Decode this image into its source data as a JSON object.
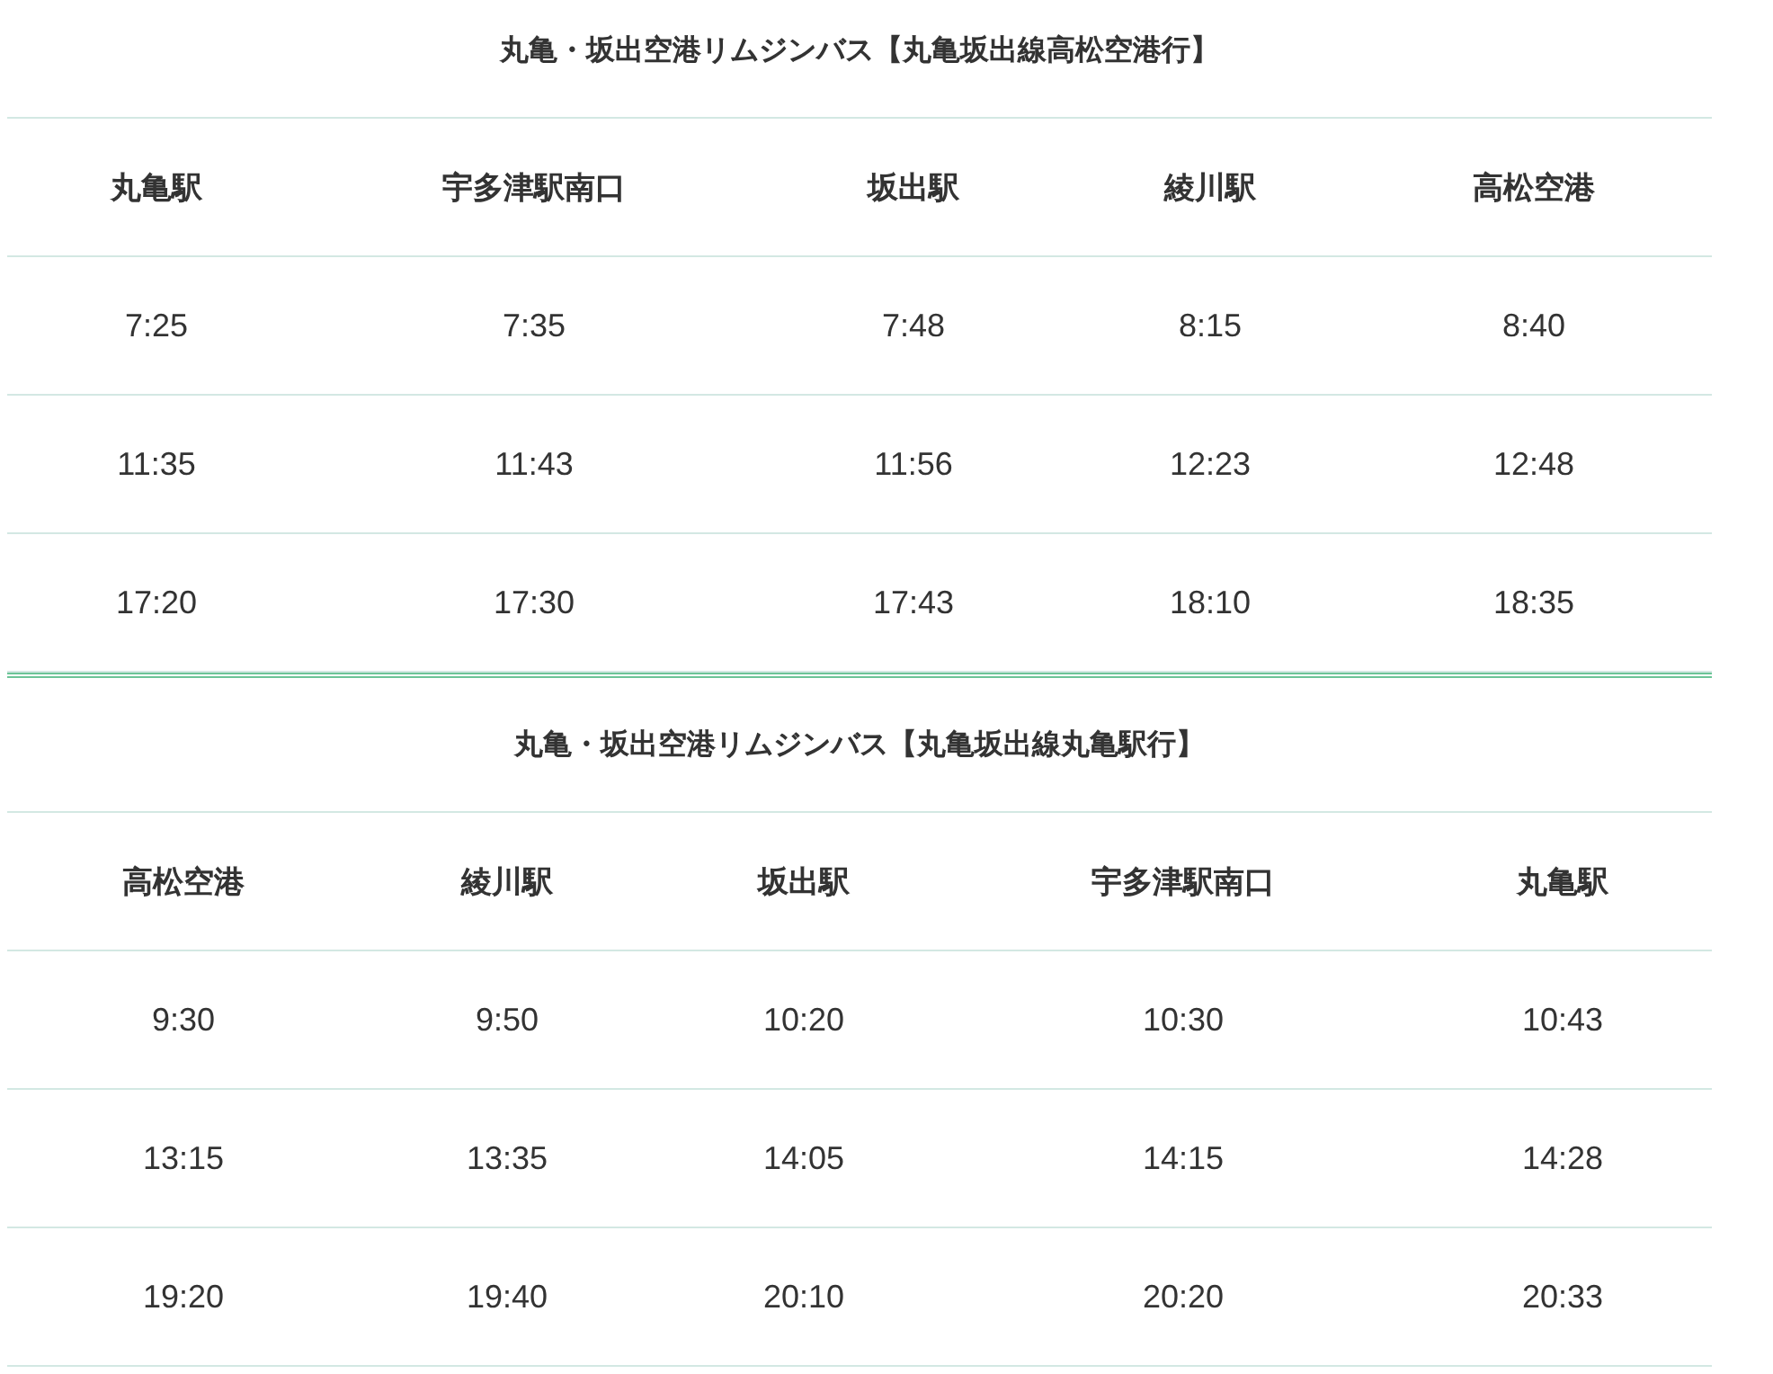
{
  "timetables": [
    {
      "title": "丸亀・坂出空港リムジンバス【丸亀坂出線高松空港行】",
      "columns": [
        "丸亀駅",
        "宇多津駅南口",
        "坂出駅",
        "綾川駅",
        "高松空港"
      ],
      "rows": [
        [
          "7:25",
          "7:35",
          "7:48",
          "8:15",
          "8:40"
        ],
        [
          "11:35",
          "11:43",
          "11:56",
          "12:23",
          "12:48"
        ],
        [
          "17:20",
          "17:30",
          "17:43",
          "18:10",
          "18:35"
        ]
      ]
    },
    {
      "title": "丸亀・坂出空港リムジンバス【丸亀坂出線丸亀駅行】",
      "columns": [
        "高松空港",
        "綾川駅",
        "坂出駅",
        "宇多津駅南口",
        "丸亀駅"
      ],
      "rows": [
        [
          "9:30",
          "9:50",
          "10:20",
          "10:30",
          "10:43"
        ],
        [
          "13:15",
          "13:35",
          "14:05",
          "14:15",
          "14:28"
        ],
        [
          "19:20",
          "19:40",
          "20:10",
          "20:20",
          "20:33"
        ]
      ]
    }
  ]
}
